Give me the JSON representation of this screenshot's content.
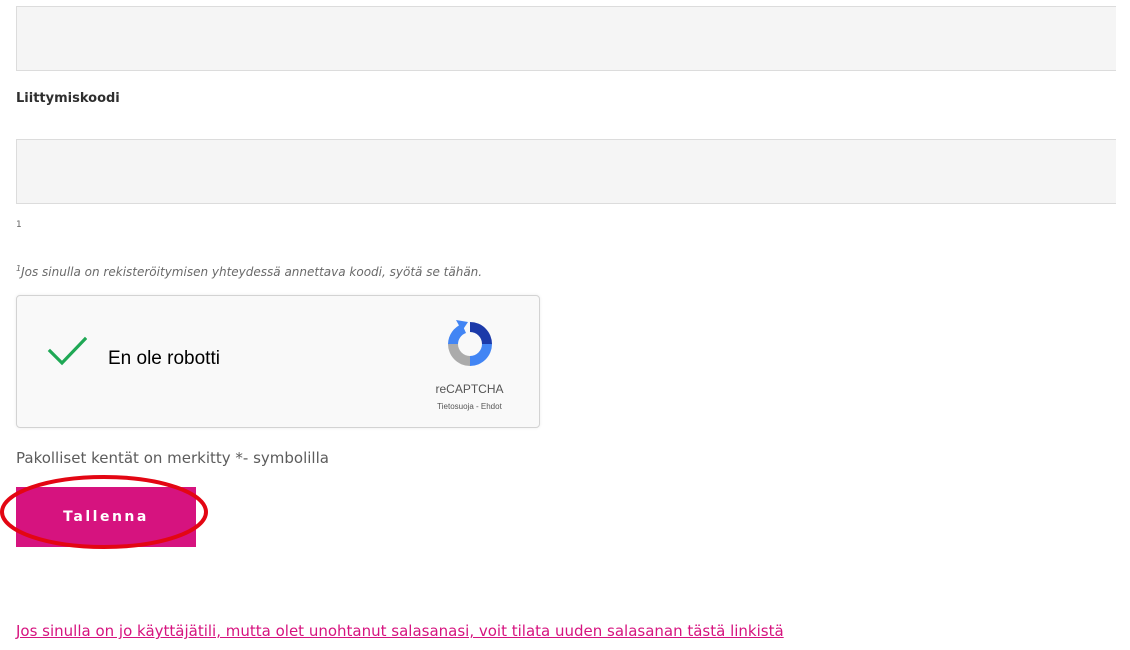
{
  "form": {
    "code_label": "Liittymiskoodi",
    "code_footnote_marker": "1",
    "footnote_sup": "1",
    "footnote_text": "Jos sinulla on rekisteröitymisen yhteydessä annettava koodi, syötä se tähän.",
    "required_note": "Pakolliset kentät on merkitty *- symbolilla",
    "save_label": "Tallenna"
  },
  "recaptcha": {
    "label": "En ole robotti",
    "brand": "reCAPTCHA",
    "terms": "Tietosuoja - Ehdot",
    "checked": true,
    "check_icon": "checkmark-icon",
    "logo_icon": "recaptcha-logo-icon"
  },
  "links": {
    "forgot_password": "Jos sinulla on jo käyttäjätili, mutta olet unohtanut salasanasi, voit tilata uuden salasanan tästä linkistä"
  },
  "colors": {
    "accent": "#d6137f",
    "highlight": "#e30613",
    "check": "#1fa855"
  }
}
